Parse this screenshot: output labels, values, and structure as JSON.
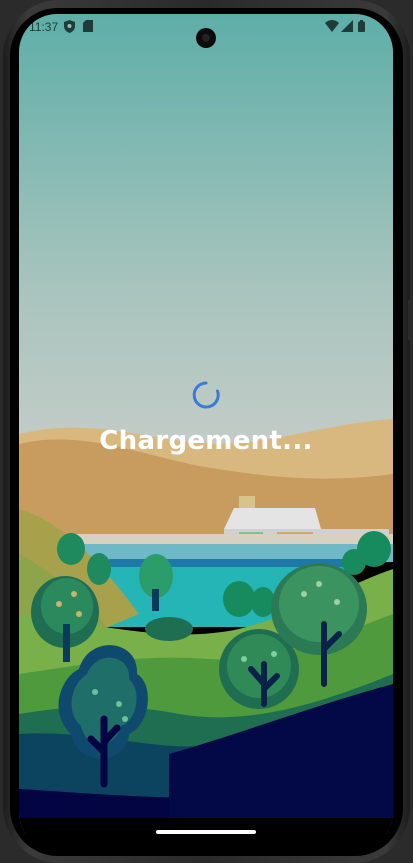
{
  "status_bar": {
    "time": "11:37",
    "left_icons": [
      "shield-icon",
      "sim-card-icon"
    ],
    "right_icons": [
      "wifi-icon",
      "signal-icon",
      "battery-icon"
    ]
  },
  "loading": {
    "text": "Chargement...",
    "spinner_color": "#3a7bd5"
  },
  "colors": {
    "sky_top": "#5eaea8",
    "sky_bottom": "#c9c9c9",
    "ground_dark": "#020542"
  }
}
